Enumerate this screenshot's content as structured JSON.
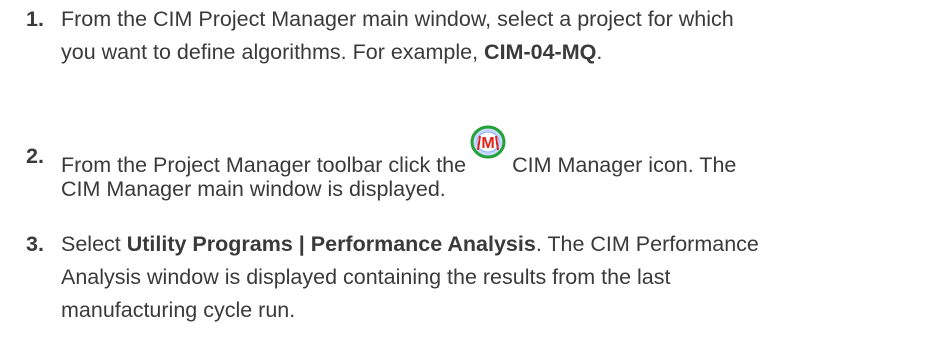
{
  "steps": [
    {
      "number": "1.",
      "line1": "From the CIM Project Manager main window, select a project for which",
      "line2_prefix": "you want to define algorithms. For example, ",
      "line2_bold": "CIM-04-MQ",
      "line2_suffix": "."
    },
    {
      "number": "2.",
      "line1_prefix": "From the Project Manager toolbar click the",
      "icon": "cim-manager-icon",
      "icon_letter": "M",
      "line1_suffix": "CIM Manager icon. The",
      "line2": "CIM Manager main window is displayed."
    },
    {
      "number": "3.",
      "line1_prefix": "Select ",
      "line1_bold": "Utility Programs | Performance Analysis",
      "line1_suffix": ". The CIM Performance",
      "line2": "Analysis window is displayed containing the results from the last",
      "line3": "manufacturing cycle run."
    }
  ],
  "colors": {
    "text": "#3a3a3a",
    "icon_ring_green": "#22a33a",
    "icon_letter_red": "#e0201b",
    "icon_fill_blue": "#c8d8ff"
  }
}
